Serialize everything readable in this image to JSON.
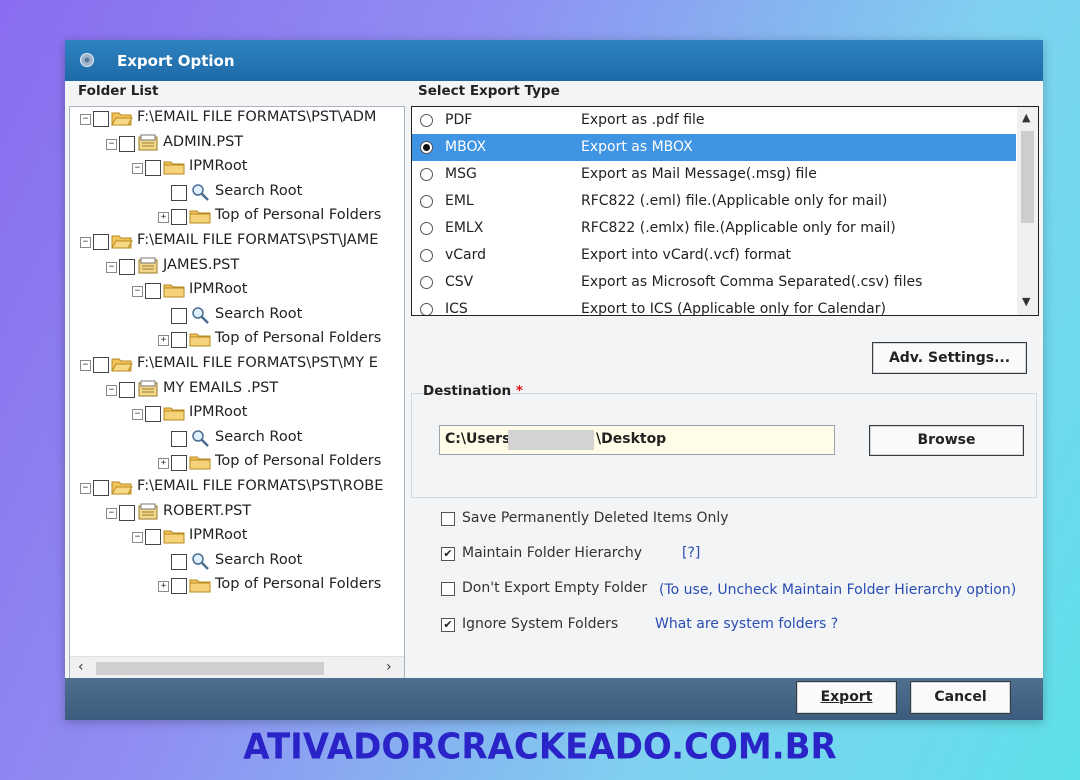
{
  "window": {
    "title": "Export Option"
  },
  "folder_list": {
    "label": "Folder List",
    "items": [
      {
        "label": "F:\\EMAIL FILE FORMATS\\PST\\ADM",
        "icon": "open-folder-icon",
        "expand": "−"
      },
      {
        "label": "ADMIN.PST",
        "icon": "pst-file-icon",
        "expand": "−"
      },
      {
        "label": "IPMRoot",
        "icon": "folder-icon",
        "expand": "−"
      },
      {
        "label": "Search Root",
        "icon": "search-folder-icon",
        "expand": ""
      },
      {
        "label": "Top of Personal Folders",
        "icon": "folder-icon",
        "expand": "+"
      },
      {
        "label": "F:\\EMAIL FILE FORMATS\\PST\\JAME",
        "icon": "open-folder-icon",
        "expand": "−"
      },
      {
        "label": "JAMES.PST",
        "icon": "pst-file-icon",
        "expand": "−"
      },
      {
        "label": "IPMRoot",
        "icon": "folder-icon",
        "expand": "−"
      },
      {
        "label": "Search Root",
        "icon": "search-folder-icon",
        "expand": ""
      },
      {
        "label": "Top of Personal Folders",
        "icon": "folder-icon",
        "expand": "+"
      },
      {
        "label": "F:\\EMAIL FILE FORMATS\\PST\\MY E",
        "icon": "open-folder-icon",
        "expand": "−"
      },
      {
        "label": "MY EMAILS .PST",
        "icon": "pst-file-icon",
        "expand": "−"
      },
      {
        "label": "IPMRoot",
        "icon": "folder-icon",
        "expand": "−"
      },
      {
        "label": "Search Root",
        "icon": "search-folder-icon",
        "expand": ""
      },
      {
        "label": "Top of Personal Folders",
        "icon": "folder-icon",
        "expand": "+"
      },
      {
        "label": "F:\\EMAIL FILE FORMATS\\PST\\ROBE",
        "icon": "open-folder-icon",
        "expand": "−"
      },
      {
        "label": "ROBERT.PST",
        "icon": "pst-file-icon",
        "expand": "−"
      },
      {
        "label": "IPMRoot",
        "icon": "folder-icon",
        "expand": "−"
      },
      {
        "label": "Search Root",
        "icon": "search-folder-icon",
        "expand": ""
      },
      {
        "label": "Top of Personal Folders",
        "icon": "folder-icon",
        "expand": "+"
      }
    ],
    "scroll_left": "‹",
    "scroll_right": "›"
  },
  "export_type": {
    "label": "Select Export Type",
    "selected": "MBOX",
    "options": [
      {
        "name": "PDF",
        "description": "Export as .pdf file"
      },
      {
        "name": "MBOX",
        "description": "Export as MBOX"
      },
      {
        "name": "MSG",
        "description": "Export as Mail Message(.msg) file"
      },
      {
        "name": "EML",
        "description": "RFC822 (.eml) file.(Applicable only for mail)"
      },
      {
        "name": "EMLX",
        "description": "RFC822 (.emlx) file.(Applicable only for mail)"
      },
      {
        "name": "vCard",
        "description": "Export into vCard(.vcf) format"
      },
      {
        "name": "CSV",
        "description": "Export as Microsoft Comma Separated(.csv) files"
      },
      {
        "name": "ICS",
        "description": "Export to ICS (Applicable only for Calendar)"
      }
    ]
  },
  "adv_settings_label": "Adv. Settings...",
  "destination": {
    "label": "Destination",
    "required_mark": "*",
    "path_prefix": "C:\\Users\\",
    "path_suffix": "\\Desktop",
    "browse_label": "Browse"
  },
  "options": {
    "save_deleted": {
      "label": "Save Permanently Deleted Items Only",
      "checked": false
    },
    "maintain_hierarchy": {
      "label": "Maintain Folder Hierarchy",
      "checked": true,
      "help_link": "[?]"
    },
    "dont_export_empty": {
      "label": "Don't Export Empty Folder",
      "checked": false,
      "note": "(To use, Uncheck Maintain Folder Hierarchy option)"
    },
    "ignore_system": {
      "label": "Ignore System Folders",
      "checked": true,
      "help_link": "What are system folders ?"
    }
  },
  "buttons": {
    "export": "Export",
    "cancel": "Cancel"
  },
  "watermark": "ATIVADORCRACKEADO.COM.BR",
  "colors": {
    "accent": "#3f94e3",
    "titlebar": "#1e6aa8",
    "bottombar": "#3b5c7e",
    "watermark": "#2a23c8"
  }
}
